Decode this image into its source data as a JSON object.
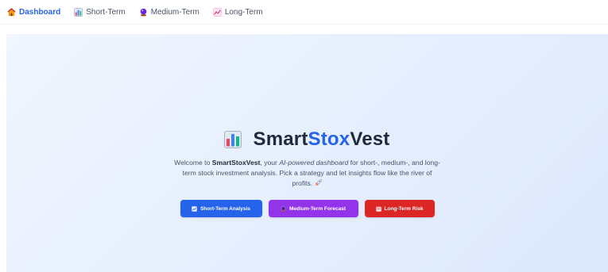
{
  "nav": {
    "items": [
      {
        "label": "Dashboard",
        "icon": "house-icon"
      },
      {
        "label": "Short-Term",
        "icon": "bar-chart-icon"
      },
      {
        "label": "Medium-Term",
        "icon": "crystal-ball-icon"
      },
      {
        "label": "Long-Term",
        "icon": "line-chart-icon"
      }
    ]
  },
  "hero": {
    "title_part1": "Smart",
    "title_part2": "Stox",
    "title_part3": "Vest",
    "desc_intro": "Welcome to ",
    "desc_brand": "SmartStoxVest",
    "desc_mid": ", your ",
    "desc_em": "AI-powered dashboard",
    "desc_rest": " for short-, medium-, and long-term stock investment analysis. Pick a strategy and let insights flow like the river of profits.",
    "desc_icon": "rocket-icon",
    "buttons": [
      {
        "label": "Short-Term Analysis",
        "icon": "chart-icon",
        "color": "#2563eb"
      },
      {
        "label": "Medium-Term Forecast",
        "icon": "crystal-ball-icon",
        "color": "#9333ea"
      },
      {
        "label": "Long-Term Risk",
        "icon": "calendar-icon",
        "color": "#dc2626"
      }
    ]
  },
  "colors": {
    "accent": "#2563eb",
    "title": "#1e293b",
    "hero_bg": "#e6effd"
  }
}
